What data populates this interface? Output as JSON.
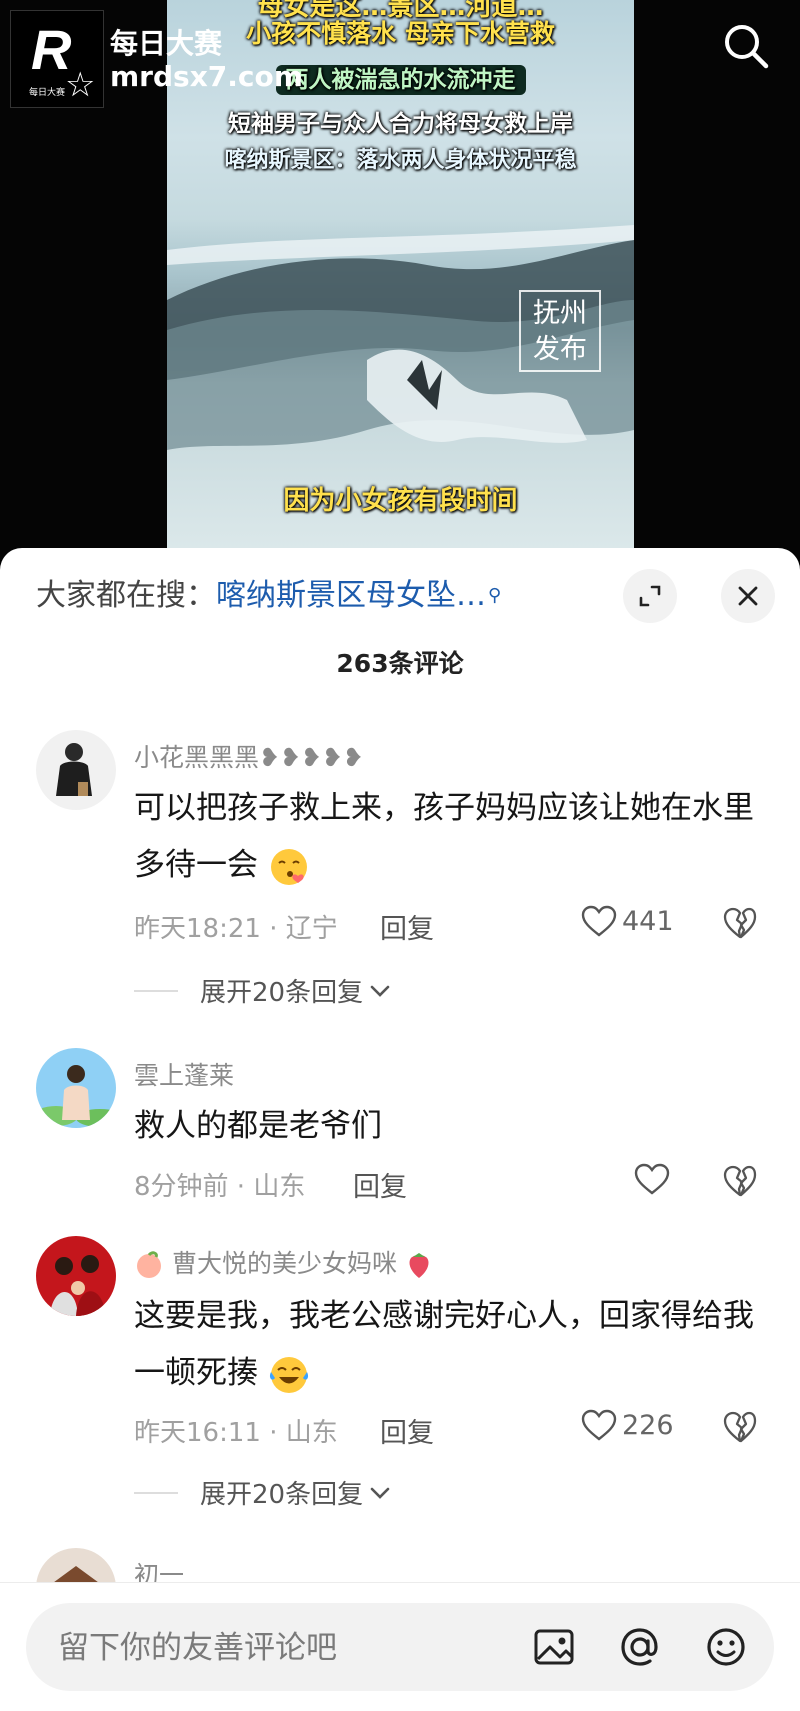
{
  "video": {
    "caption_top": "母女是这…景区…河道…",
    "caption_1": "小孩不慎落水 母亲下水营救",
    "caption_2": "两人被湍急的水流冲走",
    "caption_3": "短袖男子与众人合力将母女救上岸",
    "caption_4": "喀纳斯景区：落水两人身体状况平稳",
    "caption_bottom": "因为小女孩有段时间",
    "stamp": "抚州发布",
    "brand_name": "每日大赛",
    "brand_url": "mrdsx7.com",
    "logo_letter": "R",
    "logo_small": "每日大赛"
  },
  "sheet": {
    "search_prefix": "大家都在搜：",
    "search_link": "喀纳斯景区母女坠…",
    "comment_count": "263条评论"
  },
  "comments": [
    {
      "name": "小花黑黑黑❥❥❥❥❥",
      "text": "可以把孩子救上来，孩子妈妈应该让她在水里多待一会",
      "time": "昨天18:21 · 辽宁",
      "reply_label": "回复",
      "likes": "441",
      "expand": "展开20条回复"
    },
    {
      "name": "雲上蓬莱",
      "text": "救人的都是老爷们",
      "time": "8分钟前 · 山东",
      "reply_label": "回复",
      "likes": ""
    },
    {
      "name": "曹大悦的美少女妈咪",
      "text": "这要是我，我老公感谢完好心人，回家得给我一顿死揍",
      "time": "昨天16:11 · 山东",
      "reply_label": "回复",
      "likes": "226",
      "expand": "展开20条回复"
    },
    {
      "name": "初一"
    }
  ],
  "input": {
    "placeholder": "留下你的友善评论吧"
  },
  "icons": {
    "search": "search-icon",
    "expand": "expand-icon",
    "close": "close-icon",
    "heart": "heart-icon",
    "broken_heart": "broken-heart-icon",
    "image": "image-icon",
    "at": "at-icon",
    "emoji": "emoji-icon"
  },
  "colors": {
    "link": "#1d5cad",
    "caption_yellow": "#ffe14d",
    "meta_gray": "#a0a0a0"
  }
}
